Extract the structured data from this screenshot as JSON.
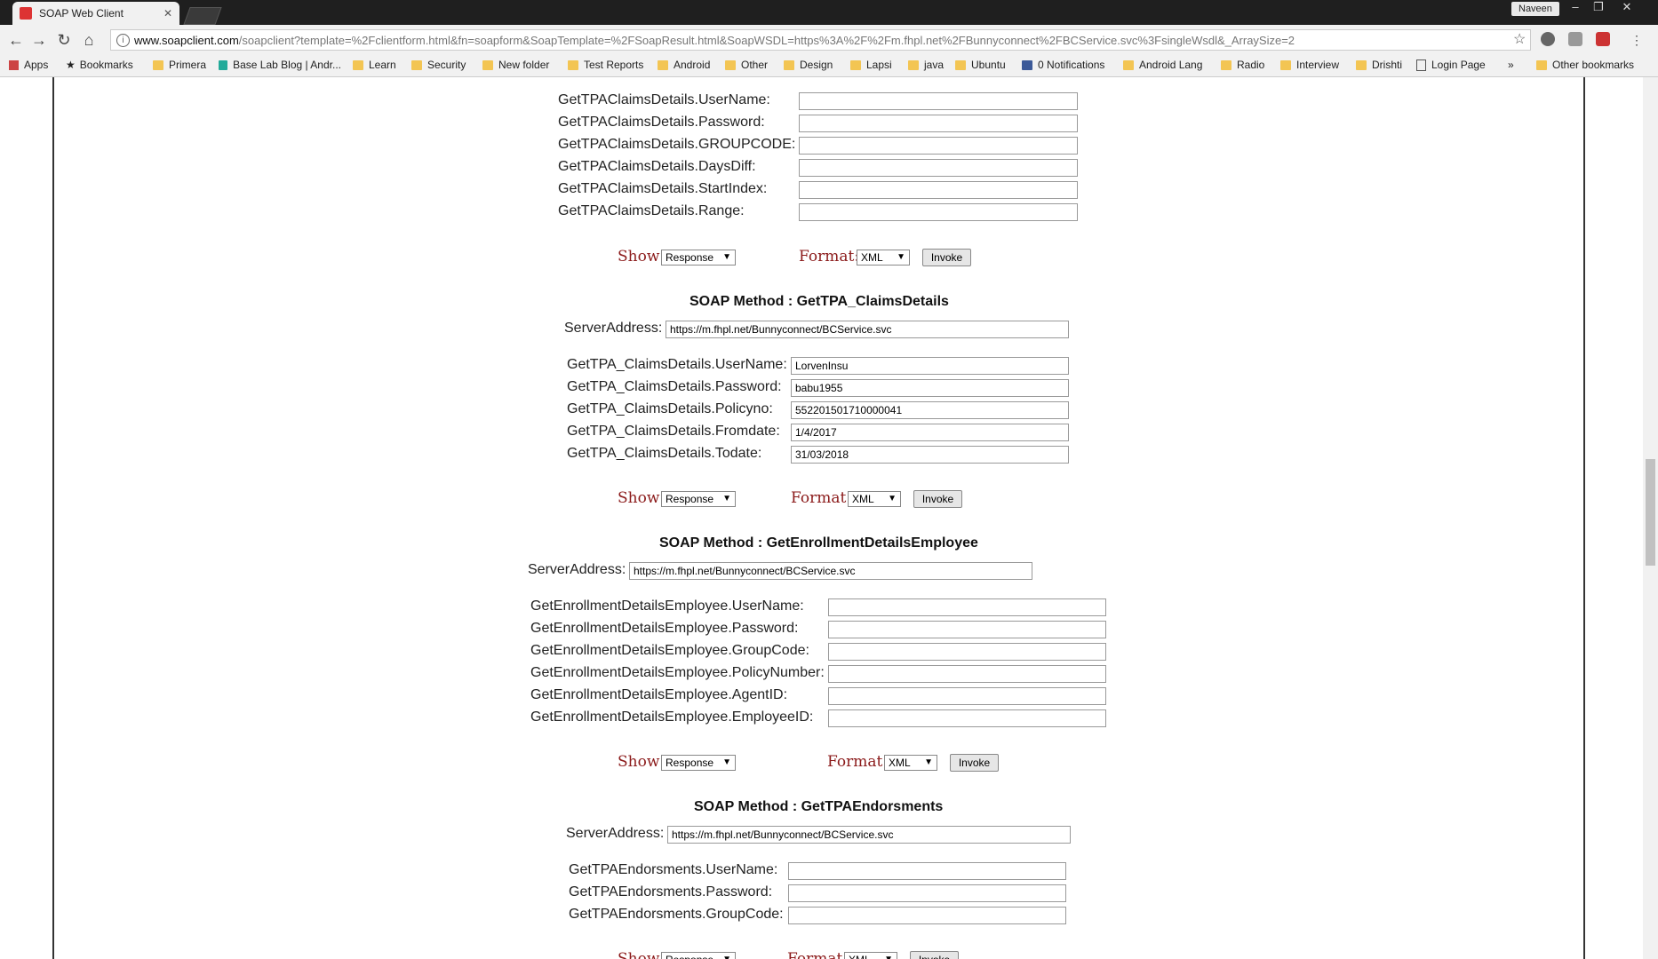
{
  "browser": {
    "tab_title": "SOAP Web Client",
    "user": "Naveen",
    "url_host": "www.soapclient.com",
    "url_path": "/soapclient?template=%2Fclientform.html&fn=soapform&SoapTemplate=%2FSoapResult.html&SoapWSDL=https%3A%2F%2Fm.fhpl.net%2FBunnyconnect%2FBCService.svc%3FsingleWsdl&_ArraySize=2"
  },
  "bookmarks": {
    "apps": "Apps",
    "items": [
      "Bookmarks",
      "Primera",
      "Base Lab Blog | Andr...",
      "Learn",
      "Security",
      "New folder",
      "Test Reports",
      "Android",
      "Other",
      "Design",
      "Lapsi",
      "java",
      "Ubuntu",
      "0 Notifications",
      "Android Lang",
      "Radio",
      "Interview",
      "Drishti",
      "Login Page"
    ],
    "more": "»",
    "other": "Other bookmarks"
  },
  "controls": {
    "show_label": "Show:",
    "format_label": "Format:",
    "show_value": "Response",
    "format_value": "XML",
    "invoke": "Invoke"
  },
  "section0": {
    "fields": [
      {
        "label": "GetTPAClaimsDetails.UserName:",
        "value": ""
      },
      {
        "label": "GetTPAClaimsDetails.Password:",
        "value": ""
      },
      {
        "label": "GetTPAClaimsDetails.GROUPCODE:",
        "value": ""
      },
      {
        "label": "GetTPAClaimsDetails.DaysDiff:",
        "value": ""
      },
      {
        "label": "GetTPAClaimsDetails.StartIndex:",
        "value": ""
      },
      {
        "label": "GetTPAClaimsDetails.Range:",
        "value": ""
      }
    ]
  },
  "section1": {
    "title": "SOAP Method : GetTPA_ClaimsDetails",
    "server_label": "ServerAddress:",
    "server_value": "https://m.fhpl.net/Bunnyconnect/BCService.svc",
    "fields": [
      {
        "label": "GetTPA_ClaimsDetails.UserName:",
        "value": "LorvenInsu"
      },
      {
        "label": "GetTPA_ClaimsDetails.Password:",
        "value": "babu1955"
      },
      {
        "label": "GetTPA_ClaimsDetails.Policyno:",
        "value": "552201501710000041"
      },
      {
        "label": "GetTPA_ClaimsDetails.Fromdate:",
        "value": "1/4/2017"
      },
      {
        "label": "GetTPA_ClaimsDetails.Todate:",
        "value": "31/03/2018"
      }
    ]
  },
  "section2": {
    "title": "SOAP Method : GetEnrollmentDetailsEmployee",
    "server_label": "ServerAddress:",
    "server_value": "https://m.fhpl.net/Bunnyconnect/BCService.svc",
    "fields": [
      {
        "label": "GetEnrollmentDetailsEmployee.UserName:",
        "value": ""
      },
      {
        "label": "GetEnrollmentDetailsEmployee.Password:",
        "value": ""
      },
      {
        "label": "GetEnrollmentDetailsEmployee.GroupCode:",
        "value": ""
      },
      {
        "label": "GetEnrollmentDetailsEmployee.PolicyNumber:",
        "value": ""
      },
      {
        "label": "GetEnrollmentDetailsEmployee.AgentID:",
        "value": ""
      },
      {
        "label": "GetEnrollmentDetailsEmployee.EmployeeID:",
        "value": ""
      }
    ]
  },
  "section3": {
    "title": "SOAP Method : GetTPAEndorsments",
    "server_label": "ServerAddress:",
    "server_value": "https://m.fhpl.net/Bunnyconnect/BCService.svc",
    "fields": [
      {
        "label": "GetTPAEndorsments.UserName:",
        "value": ""
      },
      {
        "label": "GetTPAEndorsments.Password:",
        "value": ""
      },
      {
        "label": "GetTPAEndorsments.GroupCode:",
        "value": ""
      }
    ]
  }
}
